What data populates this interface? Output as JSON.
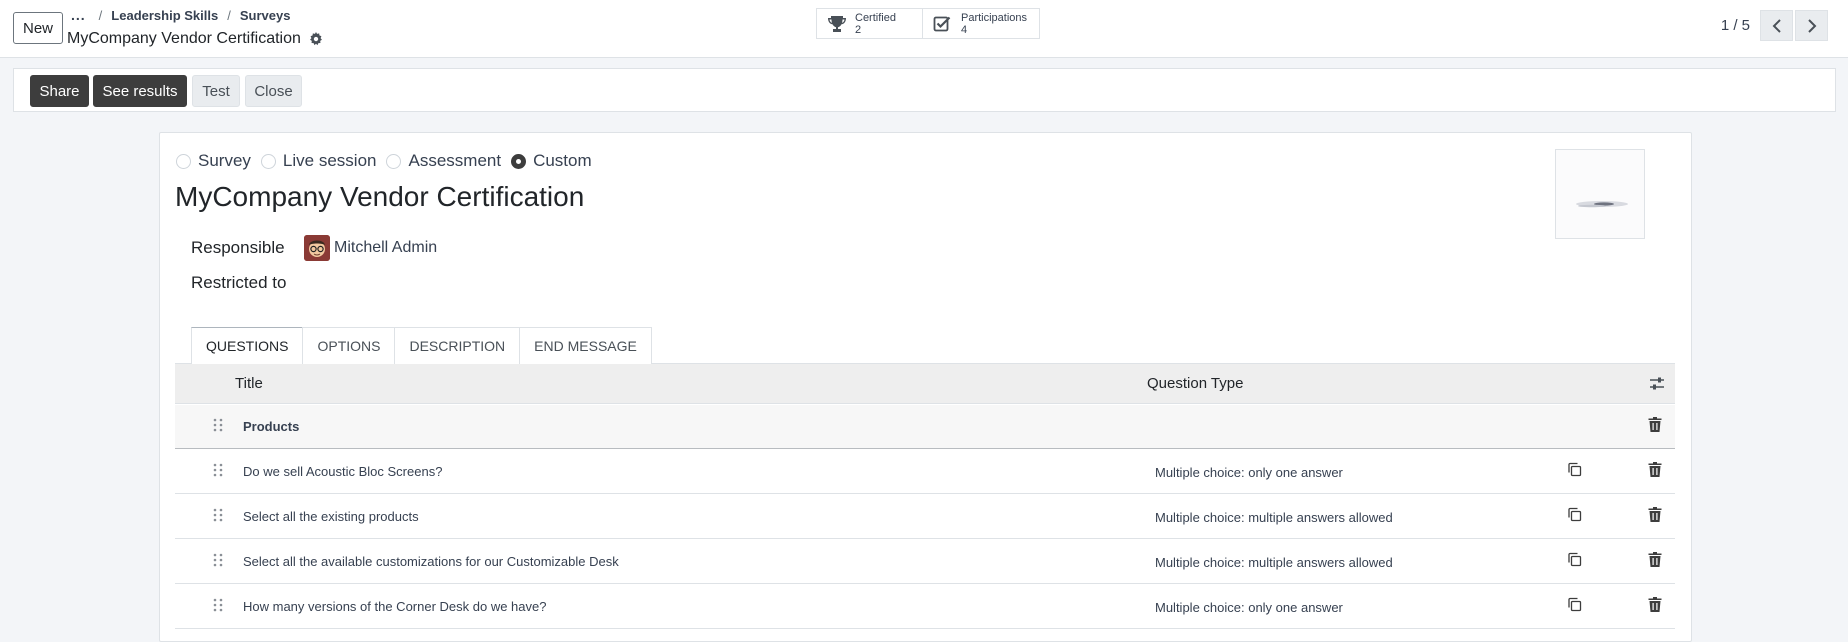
{
  "topbar": {
    "new_label": "New",
    "breadcrumb_more": "...",
    "breadcrumbs": [
      "Leadership Skills",
      "Surveys"
    ],
    "record_title": "MyCompany Vendor Certification",
    "smart_buttons": [
      {
        "label": "Certified",
        "value": "2",
        "icon": "trophy-icon"
      },
      {
        "label": "Participations",
        "value": "4",
        "icon": "checkbox-icon"
      }
    ],
    "pager": "1 / 5"
  },
  "statusbar": {
    "share": "Share",
    "see_results": "See results",
    "test": "Test",
    "close": "Close"
  },
  "form": {
    "survey_types": [
      "Survey",
      "Live session",
      "Assessment",
      "Custom"
    ],
    "selected_type": "Custom",
    "title": "MyCompany Vendor Certification",
    "responsible_label": "Responsible",
    "responsible_value": "Mitchell Admin",
    "restricted_label": "Restricted to",
    "restricted_value": ""
  },
  "tabs": [
    "QUESTIONS",
    "OPTIONS",
    "DESCRIPTION",
    "END MESSAGE"
  ],
  "active_tab": "QUESTIONS",
  "table": {
    "headers": {
      "title": "Title",
      "question_type": "Question Type"
    },
    "rows": [
      {
        "title": "Products",
        "type": "",
        "section": true
      },
      {
        "title": "Do we sell Acoustic Bloc Screens?",
        "type": "Multiple choice: only one answer",
        "section": false
      },
      {
        "title": "Select all the existing products",
        "type": "Multiple choice: multiple answers allowed",
        "section": false
      },
      {
        "title": "Select all the available customizations for our Customizable Desk",
        "type": "Multiple choice: multiple answers allowed",
        "section": false
      },
      {
        "title": "How many versions of the Corner Desk do we have?",
        "type": "Multiple choice: only one answer",
        "section": false
      }
    ]
  },
  "colors": {
    "dark_button": "#3d3d3d",
    "background": "#f3f5f8",
    "header_row": "#eeeeee"
  }
}
